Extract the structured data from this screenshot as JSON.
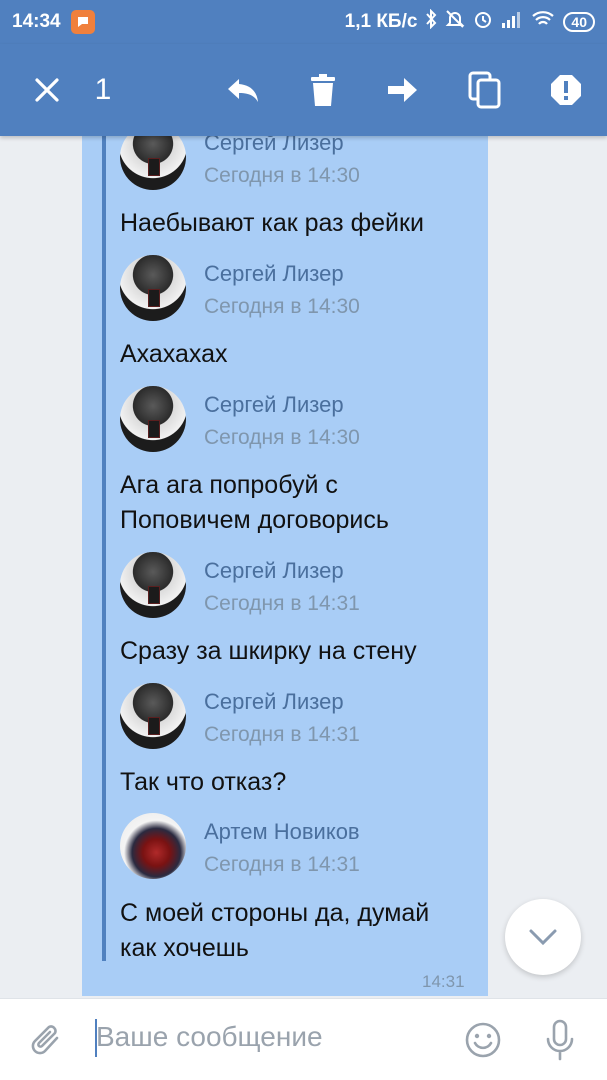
{
  "status_bar": {
    "time": "14:34",
    "network_speed": "1,1 КБ/с",
    "battery": "40"
  },
  "toolbar": {
    "selected_count": "1"
  },
  "messages": [
    {
      "sender": "Сергей Лизер",
      "date": "Сегодня в 14:30",
      "text": "Наебывают как раз фейки"
    },
    {
      "sender": "Сергей Лизер",
      "date": "Сегодня в 14:30",
      "text": "Ахахахах"
    },
    {
      "sender": "Сергей Лизер",
      "date": "Сегодня в 14:30",
      "text": "Ага ага попробуй с Поповичем договорись"
    },
    {
      "sender": "Сергей Лизер",
      "date": "Сегодня в 14:31",
      "text": "Сразу за шкирку на стену"
    },
    {
      "sender": "Сергей Лизер",
      "date": "Сегодня в 14:31",
      "text": "Так что отказ?"
    },
    {
      "sender": "Артем Новиков",
      "date": "Сегодня в 14:31",
      "text": "С моей стороны да, думай как хочешь"
    }
  ],
  "message_time": "14:31",
  "composer": {
    "placeholder": "Ваше сообщение"
  },
  "colors": {
    "header": "#5080bf",
    "bubble": "#a9cdf6",
    "sender": "#4a6f9d"
  }
}
